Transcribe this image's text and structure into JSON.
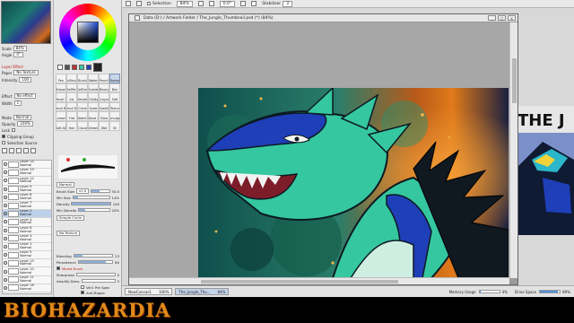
{
  "toolbar": {
    "selection_label": "Selection",
    "zoom": "84%",
    "rotation": "0.0°",
    "stabilizer_label": "Stabilizer",
    "stabilizer_value": "3"
  },
  "document": {
    "title": "Data (D:) / Artwork Folder / The_Jungle_Thumbnail.psd (*) (84%)",
    "win_minimize": "_",
    "win_maximize": "□",
    "win_close": "×"
  },
  "left_panel": {
    "scale_label": "Scale",
    "scale_value": "84%",
    "angle_label": "Angle",
    "angle_value": "0°",
    "layer_effect_label": "Layer Effect",
    "paper_label": "Paper",
    "paper_value": "No Texture",
    "intensity_label": "Intensity",
    "intensity_value": "100",
    "effect_label": "Effect",
    "effect_value": "No effect",
    "width_label": "Width",
    "width_value": "1",
    "mode_label": "Mode",
    "mode_value": "Normal",
    "opacity_label": "Opacity",
    "opacity_value": "100%",
    "lock_label": "Lock",
    "clipping_group": "Clipping Group",
    "selection_source": "Selection Source"
  },
  "layers": [
    {
      "name": "Layer 14",
      "mode": "Normal",
      "opacity": "100%",
      "selected": false
    },
    {
      "name": "Layer 13",
      "mode": "Normal",
      "opacity": "100%",
      "selected": false
    },
    {
      "name": "Layer 12",
      "mode": "Normal",
      "opacity": "100%",
      "selected": false
    },
    {
      "name": "Layer 9",
      "mode": "Normal",
      "opacity": "100%",
      "selected": false
    },
    {
      "name": "Layer 8",
      "mode": "Normal",
      "opacity": "100%",
      "selected": false
    },
    {
      "name": "Layer 7",
      "mode": "Normal",
      "opacity": "100%",
      "selected": false
    },
    {
      "name": "Layer 2",
      "mode": "Normal",
      "opacity": "100%",
      "selected": true
    },
    {
      "name": "Layer 4",
      "mode": "Normal",
      "opacity": "100%",
      "selected": false
    },
    {
      "name": "Layer 6",
      "mode": "Normal",
      "opacity": "100%",
      "selected": false
    },
    {
      "name": "Layer 3",
      "mode": "Normal",
      "opacity": "100%",
      "selected": false
    },
    {
      "name": "Layer 1",
      "mode": "Normal",
      "opacity": "100%",
      "selected": false
    },
    {
      "name": "Layer 5",
      "mode": "Normal",
      "opacity": "100%",
      "selected": false
    },
    {
      "name": "Layer 15",
      "mode": "Normal",
      "opacity": "100%",
      "selected": false
    },
    {
      "name": "Layer 10",
      "mode": "Normal",
      "opacity": "100%",
      "selected": false
    },
    {
      "name": "Layer 11",
      "mode": "Normal",
      "opacity": "100%",
      "selected": false
    },
    {
      "name": "Layer 16",
      "mode": "Normal",
      "opacity": "100%",
      "selected": false
    }
  ],
  "tools": [
    "Pen",
    "AirBrush",
    "Brush",
    "Water",
    "Pencil",
    "Marker",
    "Eraser",
    "SelPen",
    "SelEras",
    "Bucket",
    "Binary",
    "Blur",
    "Pencil 2",
    "Ink",
    "Blender",
    "Chalky",
    "Crayon",
    "Soft",
    "Pencil BE",
    "Pencil NA",
    "Circle",
    "Scale",
    "Scale2",
    "Textur",
    "Lineart",
    "Flat",
    "Sketch",
    "Blend 2",
    "Glow",
    "Smudge",
    "Soft AB",
    "Hair",
    "Cloud",
    "Detail",
    "Wet",
    "Oil"
  ],
  "brush": {
    "mode": "Normal",
    "brush_size_label": "Brush Size",
    "brush_size_mult": "x1.0",
    "brush_size_value": "30.0",
    "min_size_label": "Min Size",
    "min_size_value": "14%",
    "density_label": "Density",
    "density_value": "100",
    "min_density_label": "Min Density",
    "min_density_value": "20%",
    "shape": "Simple Circle",
    "texture": "No Texture",
    "blending_label": "Blending",
    "blending_value": "23",
    "persistence_label": "Persistence",
    "persistence_value": "80",
    "mix_label": "Mixed Brush",
    "sharpness_label": "Sharpness",
    "sharpness_value": "0",
    "amplify_label": "Amplify Dens.",
    "amplify_value": "0",
    "ver1_label": "Ver1 Pre Spec",
    "antiripple_label": "Anti-Ripple"
  },
  "background_title_text": "THE J",
  "statusbar": {
    "tab1_name": "NewCanvas1",
    "tab1_zoom": "100%",
    "tab2_name": "The_Jungle_Thu...",
    "tab2_zoom": "84%",
    "memory_label": "Memory Usage",
    "memory_percent": "4%",
    "memory_fill": 0.04,
    "drive_label": "Drive Space",
    "drive_percent": "89%",
    "drive_fill": 0.89
  },
  "watermark": "BIOHAZARDIA",
  "colors": {
    "accent_blue": "#4e8ed8",
    "watermark_orange": "#e08a1a",
    "dragon_teal": "#35c7a0",
    "dragon_blue": "#1f3fb8"
  }
}
